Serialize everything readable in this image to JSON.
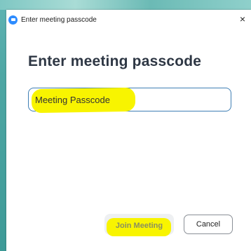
{
  "window": {
    "title": "Enter meeting passcode",
    "close_glyph": "×"
  },
  "dialog": {
    "heading": "Enter meeting passcode",
    "passcode_placeholder": "Meeting Passcode",
    "passcode_value": ""
  },
  "buttons": {
    "join_label": "Join Meeting",
    "cancel_label": "Cancel"
  },
  "icons": {
    "app_icon": "zoom-camera-icon",
    "close_icon": "close-icon"
  },
  "colors": {
    "accent_blue": "#2d8cff",
    "input_border": "#3f7fb4",
    "heading": "#2e3744",
    "highlight_marker": "#f8f400",
    "desktop_teal": "#4ea7a4"
  }
}
